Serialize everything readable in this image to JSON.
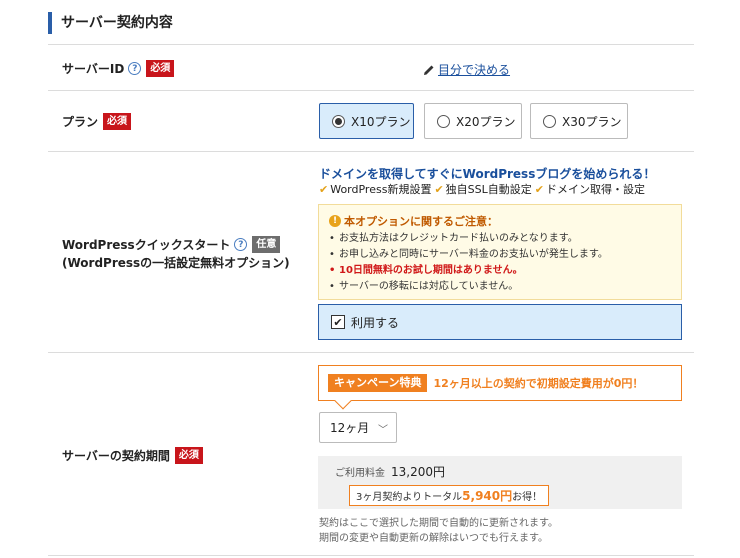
{
  "section": {
    "title": "サーバー契約内容"
  },
  "rows": {
    "server_id": {
      "label": "サーバーID",
      "required": "必須",
      "help": "?",
      "self_link": "目分で決める"
    },
    "plan": {
      "label": "プラン",
      "required": "必須",
      "options": [
        {
          "label": "X10プラン",
          "selected": true
        },
        {
          "label": "X20プラン",
          "selected": false
        },
        {
          "label": "X30プラン",
          "selected": false
        }
      ]
    },
    "wp": {
      "label": "WordPressクイックスタート",
      "help": "?",
      "optional": "任意",
      "sublabel": "(WordPressの一括設定無料オプション)",
      "headline": "ドメインを取得してすぐにWordPressブログを始められる！",
      "features": [
        "WordPress新規設置",
        "独自SSL自動設定",
        "ドメイン取得・設定"
      ],
      "notice": {
        "title": "本オプションに関するご注意：",
        "items": [
          {
            "text": "お支払方法はクレジットカード払いのみとなります。",
            "red": false
          },
          {
            "text": "お申し込みと同時にサーバー料金のお支払いが発生します。",
            "red": false
          },
          {
            "text": "10日間無料のお試し期間はありません。",
            "red": true
          },
          {
            "text": "サーバーの移転には対応していません。",
            "red": false
          }
        ]
      },
      "use_label": "利用する"
    },
    "period": {
      "label": "サーバーの契約期間",
      "required": "必須",
      "campaign_badge": "キャンペーン特典",
      "campaign_text": "12ヶ月以上の契約で初期設定費用が0円！",
      "selected": "12ヶ月",
      "price_label": "ご利用料金",
      "price": "13,200円",
      "discount_prefix": "3ヶ月契約よりトータル",
      "discount_amount": "5,940円",
      "discount_suffix": "お得！",
      "renew_1": "契約はここで選択した期間で自動的に更新されます。",
      "renew_2": "期間の変更や自動更新の解除はいつでも行えます。"
    }
  }
}
